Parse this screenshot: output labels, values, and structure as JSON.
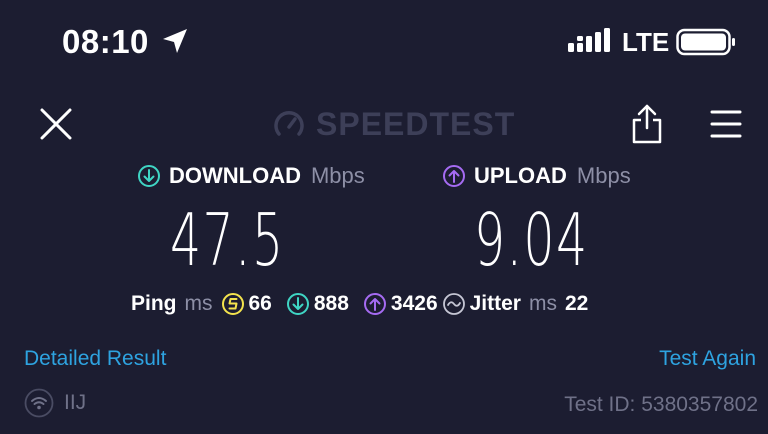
{
  "status_bar": {
    "time": "08:10",
    "network": "LTE"
  },
  "header": {
    "logo_text": "SPEEDTEST"
  },
  "download": {
    "label": "DOWNLOAD",
    "unit": "Mbps",
    "value": "47.5"
  },
  "upload": {
    "label": "UPLOAD",
    "unit": "Mbps",
    "value": "9.04"
  },
  "ping": {
    "label": "Ping",
    "unit": "ms",
    "idle": "66",
    "download": "888",
    "upload": "3426"
  },
  "jitter": {
    "label": "Jitter",
    "unit": "ms",
    "value": "22"
  },
  "links": {
    "detailed": "Detailed Result",
    "again": "Test Again"
  },
  "footer": {
    "isp": "IIJ",
    "test_id": "Test ID: 5380357802"
  },
  "colors": {
    "background": "#1c1d31",
    "download_accent": "#3fd5c4",
    "upload_accent": "#a56bf2",
    "ping_idle_accent": "#f3e34d",
    "link": "#2ea3e0"
  },
  "icons": {
    "status": [
      "location-arrow-icon",
      "signal-icon",
      "battery-icon"
    ],
    "header": [
      "close-icon",
      "speedometer-icon",
      "share-icon",
      "menu-icon"
    ],
    "metrics": [
      "download-arrow-icon",
      "upload-arrow-icon",
      "ping-idle-icon",
      "jitter-icon",
      "wifi-icon"
    ]
  }
}
